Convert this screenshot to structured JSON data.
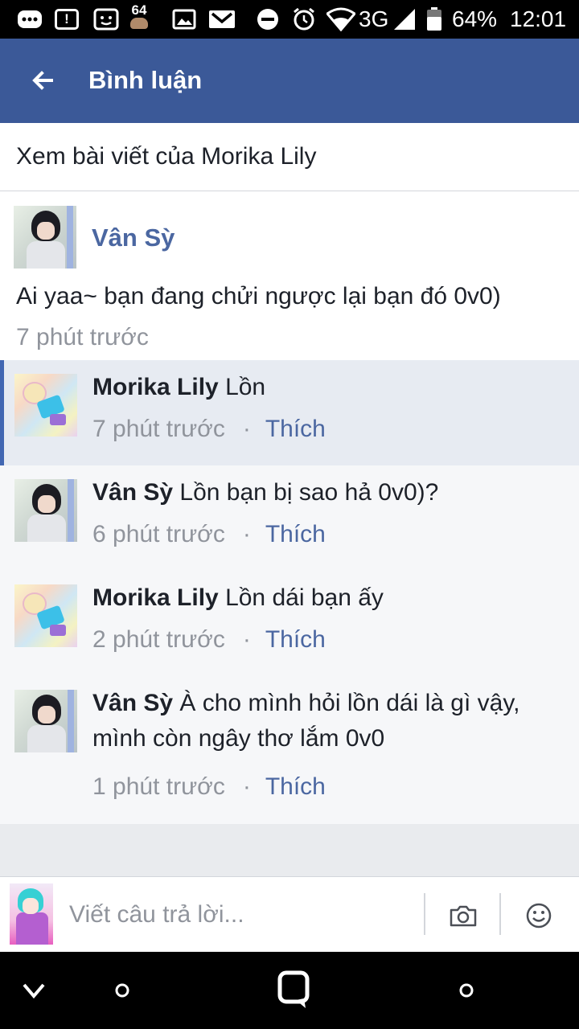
{
  "status_bar": {
    "notif_badge": "64",
    "network": "3G",
    "battery": "64%",
    "time": "12:01"
  },
  "app_bar": {
    "title": "Bình luận"
  },
  "view_post_link": "Xem bài viết của Morika Lily",
  "parent_comment": {
    "author": "Vân Sỳ",
    "text": "Ai yaa~ bạn đang chửi ngược lại bạn đó 0v0)",
    "time": "7 phút trước"
  },
  "replies": [
    {
      "author": "Morika Lily",
      "text": "Lồn",
      "time": "7 phút trước",
      "like": "Thích"
    },
    {
      "author": "Vân Sỳ",
      "text": "Lồn bạn bị sao hả 0v0)?",
      "time": "6 phút trước",
      "like": "Thích"
    },
    {
      "author": "Morika Lily",
      "text": "Lồn dái bạn ấy",
      "time": "2 phút trước",
      "like": "Thích"
    },
    {
      "author": "Vân Sỳ",
      "text": "À cho mình hỏi lồn dái là gì vậy, mình còn ngây thơ lắm 0v0",
      "time": "1 phút trước",
      "like": "Thích"
    }
  ],
  "separator_dot": "·",
  "composer": {
    "placeholder": "Viết câu trả lời..."
  },
  "colors": {
    "brand_blue": "#3b5998",
    "link_blue": "#4b67a1",
    "highlight_bar": "#4267b2",
    "secondary_text": "#90949c"
  },
  "icons": {
    "app_bar": [
      "back-arrow-icon"
    ],
    "composer": [
      "camera-icon",
      "smiley-icon"
    ],
    "navigation": [
      "nav-back-icon",
      "nav-home-icon",
      "nav-app-icon",
      "nav-recents-icon"
    ]
  }
}
